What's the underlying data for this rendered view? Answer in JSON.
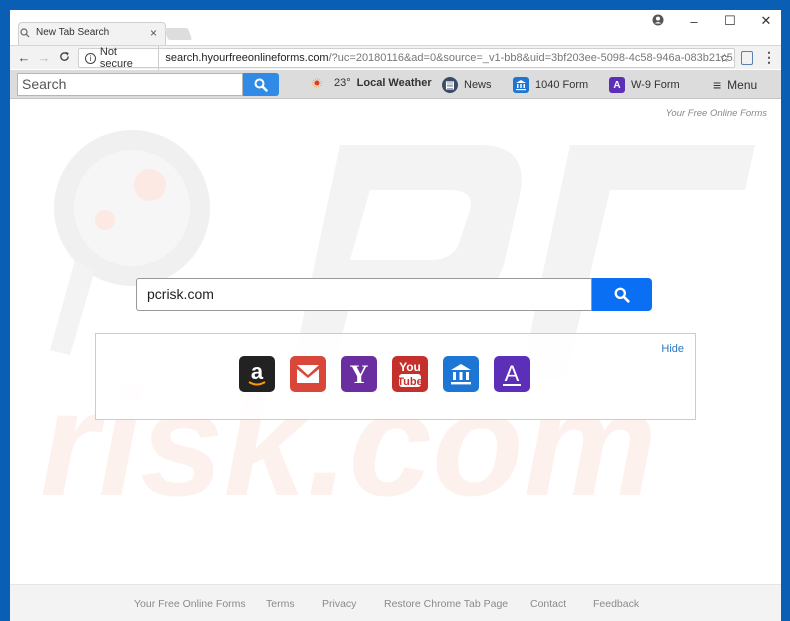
{
  "browser": {
    "tab_title": "New Tab Search",
    "tab_close": "×",
    "window_controls": {
      "account": "account-icon",
      "minimize": "–",
      "maximize": "☐",
      "close": "✕"
    },
    "nav": {
      "back": "←",
      "forward": "→",
      "reload": "C"
    },
    "omnibox": {
      "security_label": "Not secure",
      "url_host": "search.hyourfreeonlineforms.com",
      "url_rest": "/?uc=20180116&ad=0&source=_v1-bb8&uid=3bf203ee-5098-4c58-946a-083b21c5..."
    }
  },
  "extbar": {
    "search_placeholder": "Search",
    "weather_temp": "23°",
    "weather_label": "Local Weather",
    "news_label": "News",
    "form1040_label": "1040 Form",
    "w9_label": "W-9 Form",
    "menu_label": "Menu"
  },
  "page": {
    "brand": "Your Free Online Forms",
    "search_value": "pcrisk.com",
    "hide_label": "Hide",
    "tiles": [
      {
        "name": "amazon",
        "glyph": "a",
        "color": "#222222"
      },
      {
        "name": "gmail",
        "glyph": "✉",
        "color": "#d9463a"
      },
      {
        "name": "yahoo",
        "glyph": "Y",
        "color": "#6a2ea0"
      },
      {
        "name": "youtube",
        "glyph": "You Tube",
        "color": "#c4302b"
      },
      {
        "name": "irs-forms",
        "glyph": "🏛",
        "color": "#1d76d4"
      },
      {
        "name": "w9-forms",
        "glyph": "A",
        "color": "#5c2fb8"
      }
    ],
    "footer_links": [
      "Your Free Online Forms",
      "Terms",
      "Privacy",
      "Restore Chrome Tab Page",
      "Contact",
      "Feedback"
    ]
  },
  "colors": {
    "accent_blue": "#0a6ff2",
    "frame_blue": "#0a5fb4",
    "link_blue": "#2b78c2"
  }
}
